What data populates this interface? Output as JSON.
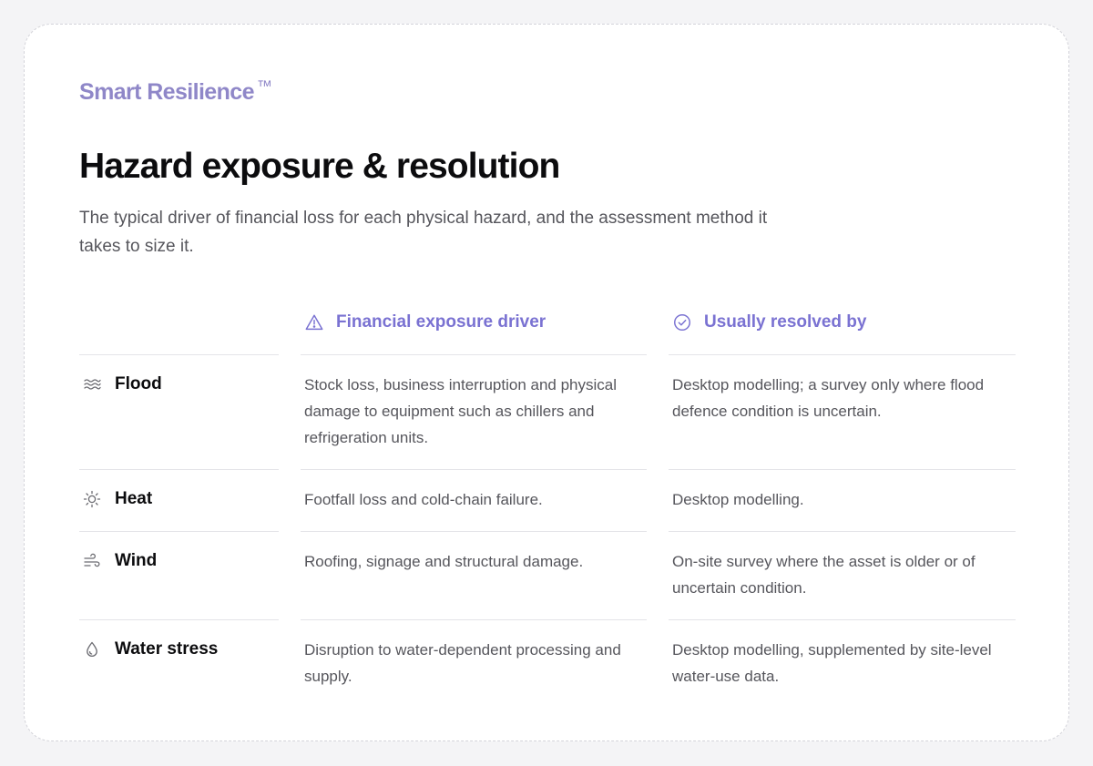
{
  "brand": {
    "name": "Smart Resilience",
    "trademark": "™"
  },
  "page": {
    "title": "Hazard exposure & resolution",
    "subtitle": "The typical driver of financial loss for each physical hazard, and the assessment method it takes to size it."
  },
  "table": {
    "columns": {
      "driver": {
        "label": "Financial exposure driver",
        "icon": "warning-triangle-icon"
      },
      "resolved": {
        "label": "Usually resolved by",
        "icon": "check-circle-icon"
      }
    },
    "rows": [
      {
        "hazard": "Flood",
        "icon": "waves-icon",
        "driver": "Stock loss, business interruption and physical damage to equipment such as chillers and refrigeration units.",
        "resolved": "Desktop modelling; a survey only where flood defence condition is uncertain."
      },
      {
        "hazard": "Heat",
        "icon": "sun-icon",
        "driver": "Footfall loss and cold-chain failure.",
        "resolved": "Desktop modelling."
      },
      {
        "hazard": "Wind",
        "icon": "wind-icon",
        "driver": "Roofing, signage and structural damage.",
        "resolved": "On-site survey where the asset is older or of uncertain condition."
      },
      {
        "hazard": "Water stress",
        "icon": "droplet-icon",
        "driver": "Disruption to water-dependent processing and supply.",
        "resolved": "Desktop modelling, supplemented by site-level water-use data."
      }
    ]
  },
  "colors": {
    "accent": "#7a72d2",
    "brand": "#8f87c8",
    "heading": "#0c0c0e",
    "body_text": "#56565c",
    "divider": "#e4e4e8",
    "background": "#f4f4f6",
    "card": "#ffffff"
  }
}
